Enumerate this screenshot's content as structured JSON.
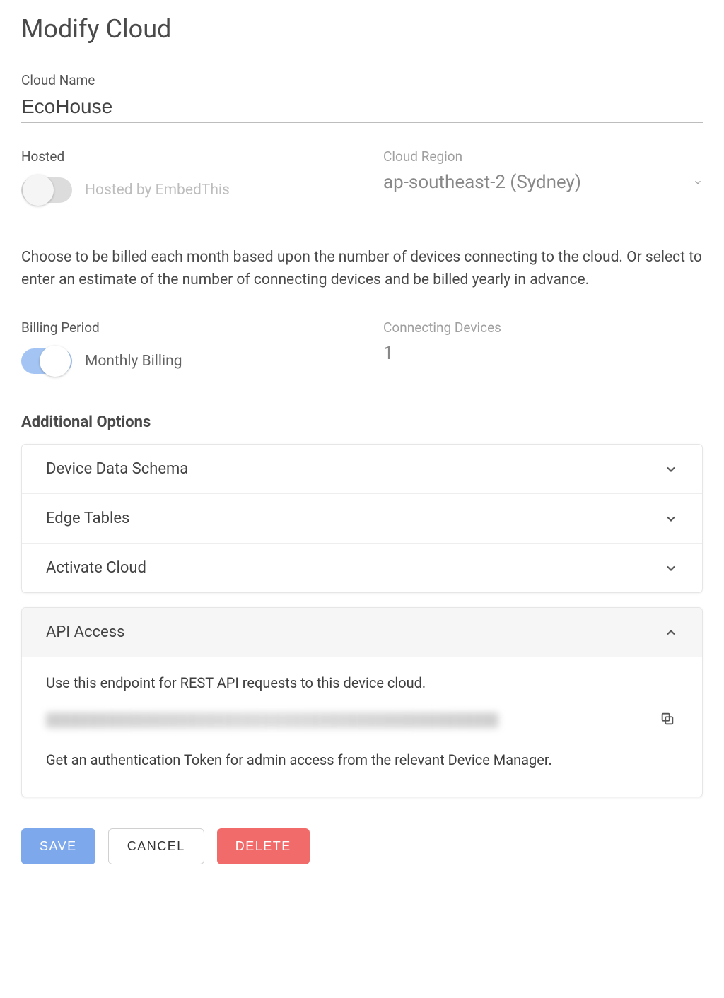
{
  "title": "Modify Cloud",
  "cloudName": {
    "label": "Cloud Name",
    "value": "EcoHouse"
  },
  "hosted": {
    "label": "Hosted",
    "toggleLabel": "Hosted by EmbedThis",
    "on": false
  },
  "region": {
    "label": "Cloud Region",
    "value": "ap-southeast-2 (Sydney)"
  },
  "billingDescription": "Choose to be billed each month based upon the number of devices connecting to the cloud. Or select to enter an estimate of the number of connecting devices and be billed yearly in advance.",
  "billingPeriod": {
    "label": "Billing Period",
    "toggleLabel": "Monthly Billing",
    "on": true
  },
  "connectingDevices": {
    "label": "Connecting Devices",
    "value": "1"
  },
  "additionalOptionsHeading": "Additional Options",
  "panels": {
    "deviceDataSchema": "Device Data Schema",
    "edgeTables": "Edge Tables",
    "activateCloud": "Activate Cloud"
  },
  "apiAccess": {
    "title": "API Access",
    "intro": "Use this endpoint for REST API requests to this device cloud.",
    "note": "Get an authentication Token for admin access from the relevant Device Manager."
  },
  "buttons": {
    "save": "SAVE",
    "cancel": "CANCEL",
    "delete": "DELETE"
  }
}
